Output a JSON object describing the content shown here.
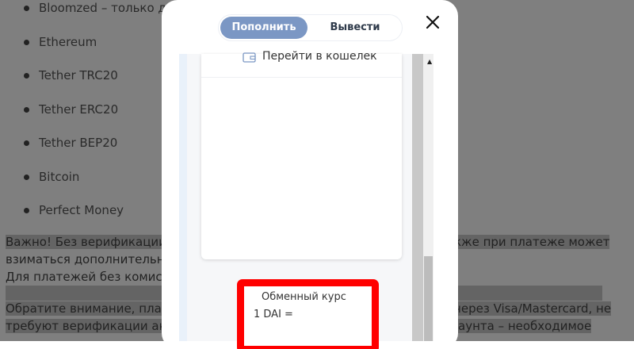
{
  "background": {
    "list_items": [
      "Bloomzed – только дл",
      "Ethereum",
      "Tether TRC20",
      "Tether ERC20",
      "Tether BEP20",
      "Bitcoin",
      "Perfect Money"
    ],
    "paragraph_1_left": "Важно! Без верификации н",
    "paragraph_1_right": "кже при платеже может",
    "paragraph_2": "взиматься дополнительная",
    "paragraph_3": "Для платежей без комисси",
    "paragraph_4_left": "Обратите внимание, плате",
    "paragraph_4_right": "через Visa/Mastercard, не",
    "paragraph_5_left": "требуют верификации акка",
    "paragraph_5_right": "аунта – необходимое"
  },
  "modal": {
    "tabs": {
      "deposit_label": "Пополнить",
      "withdraw_label": "Вывести"
    },
    "close_icon": "close-icon",
    "wallet_link": "Перейти в кошелек",
    "rate": {
      "title": "Обменный курс",
      "value": "1 DAI ="
    }
  },
  "colors": {
    "accent": "#7b97c4",
    "highlight_border": "#ff0000",
    "overlay": "#000000"
  }
}
